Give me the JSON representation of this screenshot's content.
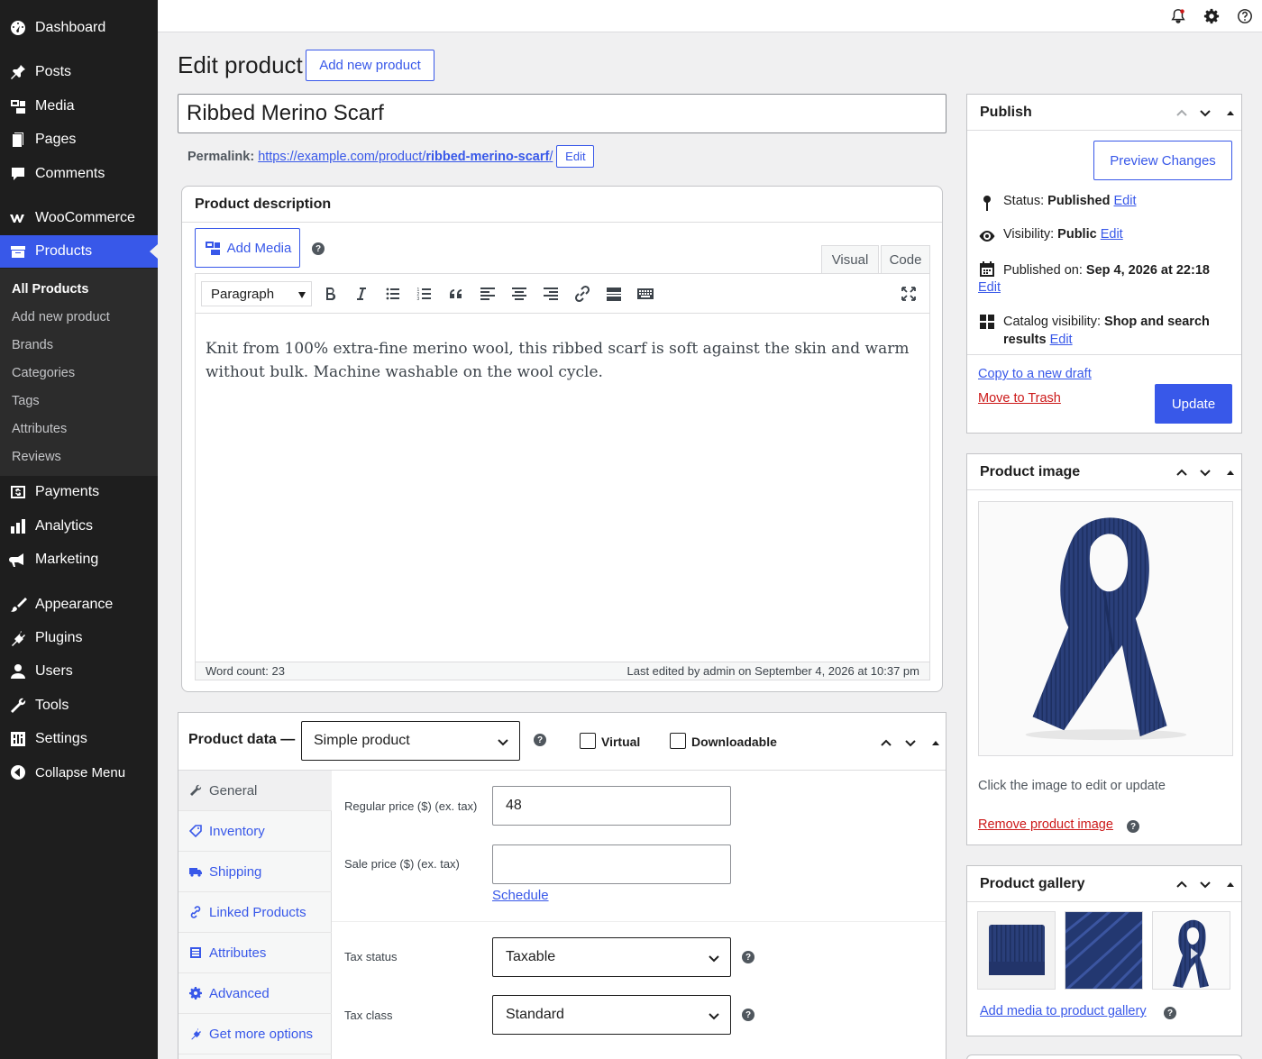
{
  "sidebar": {
    "items": [
      {
        "label": "Dashboard",
        "icon": "dashboard-icon"
      },
      {
        "label": "Posts",
        "icon": "pin-icon"
      },
      {
        "label": "Media",
        "icon": "media-icon"
      },
      {
        "label": "Pages",
        "icon": "pages-icon"
      },
      {
        "label": "Comments",
        "icon": "comment-icon"
      },
      {
        "label": "WooCommerce",
        "icon": "woocommerce-icon"
      },
      {
        "label": "Products",
        "icon": "archive-icon"
      },
      {
        "label": "Payments",
        "icon": "payments-icon"
      },
      {
        "label": "Analytics",
        "icon": "chart-bar-icon"
      },
      {
        "label": "Marketing",
        "icon": "megaphone-icon"
      },
      {
        "label": "Appearance",
        "icon": "brush-icon"
      },
      {
        "label": "Plugins",
        "icon": "plugin-icon"
      },
      {
        "label": "Users",
        "icon": "user-icon"
      },
      {
        "label": "Tools",
        "icon": "wrench-icon"
      },
      {
        "label": "Settings",
        "icon": "settings-icon"
      },
      {
        "label": "Collapse Menu",
        "icon": "collapse-icon"
      }
    ],
    "submenu": [
      "All Products",
      "Add new product",
      "Brands",
      "Categories",
      "Tags",
      "Attributes",
      "Reviews"
    ]
  },
  "topbar": {
    "icons": [
      "notification-bell-icon",
      "gear-icon",
      "help-icon"
    ]
  },
  "header": {
    "title": "Edit product",
    "add_new_label": "Add new product",
    "product_title": "Ribbed Merino Scarf",
    "permalink_label": "Permalink:",
    "permalink_base": "https://example.com/product/",
    "permalink_slug": "ribbed-merino-scarf",
    "permalink_trailing": "/",
    "permalink_edit": "Edit"
  },
  "description": {
    "panel_title": "Product description",
    "add_media": "Add Media",
    "tabs": [
      "Visual",
      "Code"
    ],
    "format": "Paragraph",
    "content": "Knit from 100% extra-fine merino wool, this ribbed scarf is soft against the skin and warm without bulk. Machine washable on the wool cycle.",
    "word_count": "Word count: 23",
    "last_edited": "Last edited by admin on September 4, 2026 at 10:37 pm"
  },
  "product_data": {
    "title": "Product data —",
    "type": "Simple product",
    "virtual_label": "Virtual",
    "downloadable_label": "Downloadable",
    "tabs": [
      "General",
      "Inventory",
      "Shipping",
      "Linked Products",
      "Attributes",
      "Advanced",
      "Get more options"
    ],
    "regular_price_label": "Regular price ($) (ex. tax)",
    "regular_price": "48",
    "sale_price_label": "Sale price ($) (ex. tax)",
    "sale_price": "",
    "schedule": "Schedule",
    "tax_status_label": "Tax status",
    "tax_status": "Taxable",
    "tax_class_label": "Tax class",
    "tax_class": "Standard"
  },
  "publish": {
    "title": "Publish",
    "preview": "Preview Changes",
    "status_label": "Status:",
    "status": "Published",
    "visibility_label": "Visibility:",
    "visibility": "Public",
    "published_label": "Published on:",
    "published_on": "Sep 4, 2026 at 22:18",
    "catalog_label": "Catalog visibility:",
    "catalog": "Shop and search results",
    "edit": "Edit",
    "copy_draft": "Copy to a new draft",
    "trash": "Move to Trash",
    "update": "Update"
  },
  "product_image": {
    "title": "Product image",
    "hint": "Click the image to edit or update",
    "remove": "Remove product image"
  },
  "gallery": {
    "title": "Product gallery",
    "add": "Add media to product gallery"
  },
  "colors": {
    "accent": "#3858e9",
    "sidebar": "#1e1e1e",
    "danger": "#cc1818",
    "scarf": "#2a3f7a"
  }
}
